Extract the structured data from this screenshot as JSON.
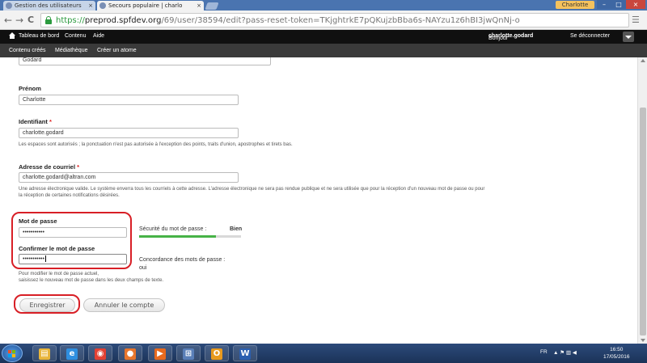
{
  "browser": {
    "tabs": [
      {
        "label": "Gestion des utilisateurs",
        "close": "×"
      },
      {
        "label": "Secours populaire | charlo",
        "close": "×"
      }
    ],
    "profile_name": "Charlotte",
    "window_controls": {
      "minimize": "–",
      "maximize": "□",
      "close": "×"
    },
    "nav": {
      "back": "←",
      "forward": "→",
      "reload": "C"
    },
    "url": {
      "scheme": "https://",
      "host": "preprod.spfdev.org",
      "path": "/69/user/38594/edit?pass-reset-token=TKjghtrkE7pQKujzbBba6s-NAYzu1z6hBI3jwQnNj-o"
    },
    "bookmark_icon": "☆"
  },
  "admin_toolbar": {
    "items": [
      "Tableau de bord",
      "Contenu",
      "Aide"
    ],
    "greeting_prefix": "Bonjour",
    "username": "charlotte.godard",
    "logout": "Se déconnecter"
  },
  "shortcuts": {
    "items": [
      "Contenu créés",
      "Médiathèque",
      "Créer un atome"
    ]
  },
  "form": {
    "nom_value": "Godard",
    "prenom": {
      "label": "Prénom",
      "value": "Charlotte"
    },
    "identifiant": {
      "label": "Identifiant",
      "required": "*",
      "value": "charlotte.godard",
      "description": "Les espaces sont autorisés ; la ponctuation n'est pas autorisée à l'exception des points, traits d'union, apostrophes et tirets bas."
    },
    "email": {
      "label": "Adresse de courriel",
      "required": "*",
      "value": "charlotte.godard@altran.com",
      "description_line1": "Une adresse électronique valide. Le système enverra tous les courriels à cette adresse. L'adresse électronique ne sera pas rendue publique et ne sera utilisée que pour la réception d'un nouveau mot de passe ou pour",
      "description_line2": "la réception de certaines notifications désirées."
    },
    "password": {
      "label": "Mot de passe",
      "value": "•••••••••••",
      "strength_label": "Sécurité du mot de passe :",
      "strength_value": "Bien",
      "strength_level": 0.75
    },
    "confirm": {
      "label": "Confirmer le mot de passe",
      "value": "•••••••••••",
      "match_label": "Concordance des mots de passe :",
      "match_value": "oui"
    },
    "password_help_line1": "Pour modifier le mot de passe actuel,",
    "password_help_line2": "saisissez le nouveau mot de passe dans les deux champs de texte.",
    "save_button": "Enregistrer",
    "cancel_account_button": "Annuler le compte"
  },
  "taskbar": {
    "apps": [
      {
        "icon": "file-explorer-icon",
        "glyph": "▤",
        "color": "#e8b53a"
      },
      {
        "icon": "internet-explorer-icon",
        "glyph": "e",
        "color": "#2f8fe0"
      },
      {
        "icon": "chrome-icon",
        "glyph": "◉",
        "color": "#e34133"
      },
      {
        "icon": "firefox-icon",
        "glyph": "●",
        "color": "#e8762c"
      },
      {
        "icon": "media-player-icon",
        "glyph": "▶",
        "color": "#e86a1e"
      },
      {
        "icon": "network-app-icon",
        "glyph": "⊞",
        "color": "#5a7fb8"
      },
      {
        "icon": "outlook-icon",
        "glyph": "O",
        "color": "#e89a1e"
      },
      {
        "icon": "word-icon",
        "glyph": "W",
        "color": "#2b5fb0"
      }
    ],
    "language": "FR",
    "tray_icons": "▲  ⚑  ▥  ◀",
    "time": "16:50",
    "date": "17/05/2016"
  },
  "colors": {
    "required_star": "#e02020",
    "highlight_box": "#d81f26",
    "strength_fill": "#47b347",
    "url_scheme": "#2b9a3e"
  }
}
